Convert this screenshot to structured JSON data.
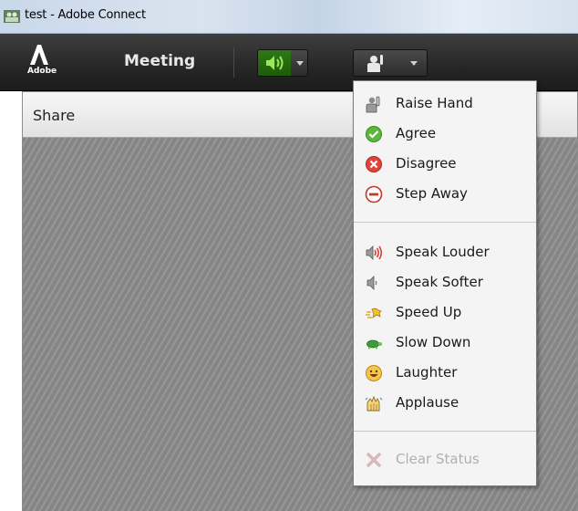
{
  "window": {
    "title": "test - Adobe Connect"
  },
  "toolbar": {
    "logo_text": "Adobe",
    "meeting_menu": "Meeting"
  },
  "pod": {
    "title": "Share"
  },
  "status_menu": {
    "group1": [
      {
        "label": "Raise Hand",
        "icon": "raise-hand-icon"
      },
      {
        "label": "Agree",
        "icon": "agree-check-icon"
      },
      {
        "label": "Disagree",
        "icon": "disagree-x-icon"
      },
      {
        "label": "Step Away",
        "icon": "step-away-icon"
      }
    ],
    "group2": [
      {
        "label": "Speak Louder",
        "icon": "speak-louder-icon"
      },
      {
        "label": "Speak Softer",
        "icon": "speak-softer-icon"
      },
      {
        "label": "Speed Up",
        "icon": "speed-up-icon"
      },
      {
        "label": "Slow Down",
        "icon": "slow-down-turtle-icon"
      },
      {
        "label": "Laughter",
        "icon": "laughter-smiley-icon"
      },
      {
        "label": "Applause",
        "icon": "applause-hands-icon"
      }
    ],
    "group3": [
      {
        "label": "Clear Status",
        "icon": "clear-status-icon",
        "disabled": true
      }
    ]
  },
  "colors": {
    "toolbar_bg": "#262626",
    "speaker_active": "#2d7a14",
    "menu_bg": "#f4f4f4",
    "disabled_text": "#b0b0b0"
  }
}
